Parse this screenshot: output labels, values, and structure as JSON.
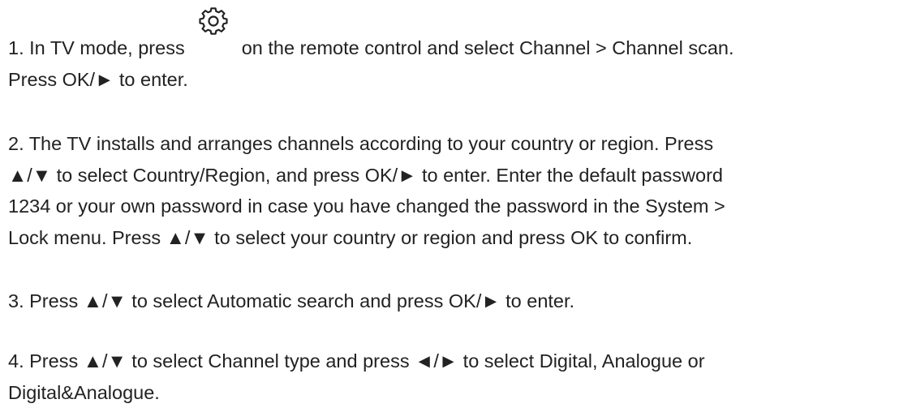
{
  "steps": {
    "s1": {
      "l1a": "1. In TV mode, press",
      "icon": "gear-icon",
      "l1b": "on the remote control and select Channel > Channel scan.",
      "l2": "Press OK/► to enter."
    },
    "s2": {
      "l1": "2. The TV installs and arranges channels according to your country or region. Press",
      "l2": "▲/▼ to select Country/Region, and press OK/► to enter. Enter the default password",
      "l3": "1234 or your own password in case you have changed the password in the System >",
      "l4": "Lock menu. Press ▲/▼ to select your country or region and press OK to confirm."
    },
    "s3": {
      "l1": "3. Press ▲/▼ to select Automatic search and press OK/► to enter."
    },
    "s4": {
      "l1": "4. Press ▲/▼ to select Channel type and press ◄/► to select Digital, Analogue or",
      "l2": "Digital&Analogue."
    }
  }
}
